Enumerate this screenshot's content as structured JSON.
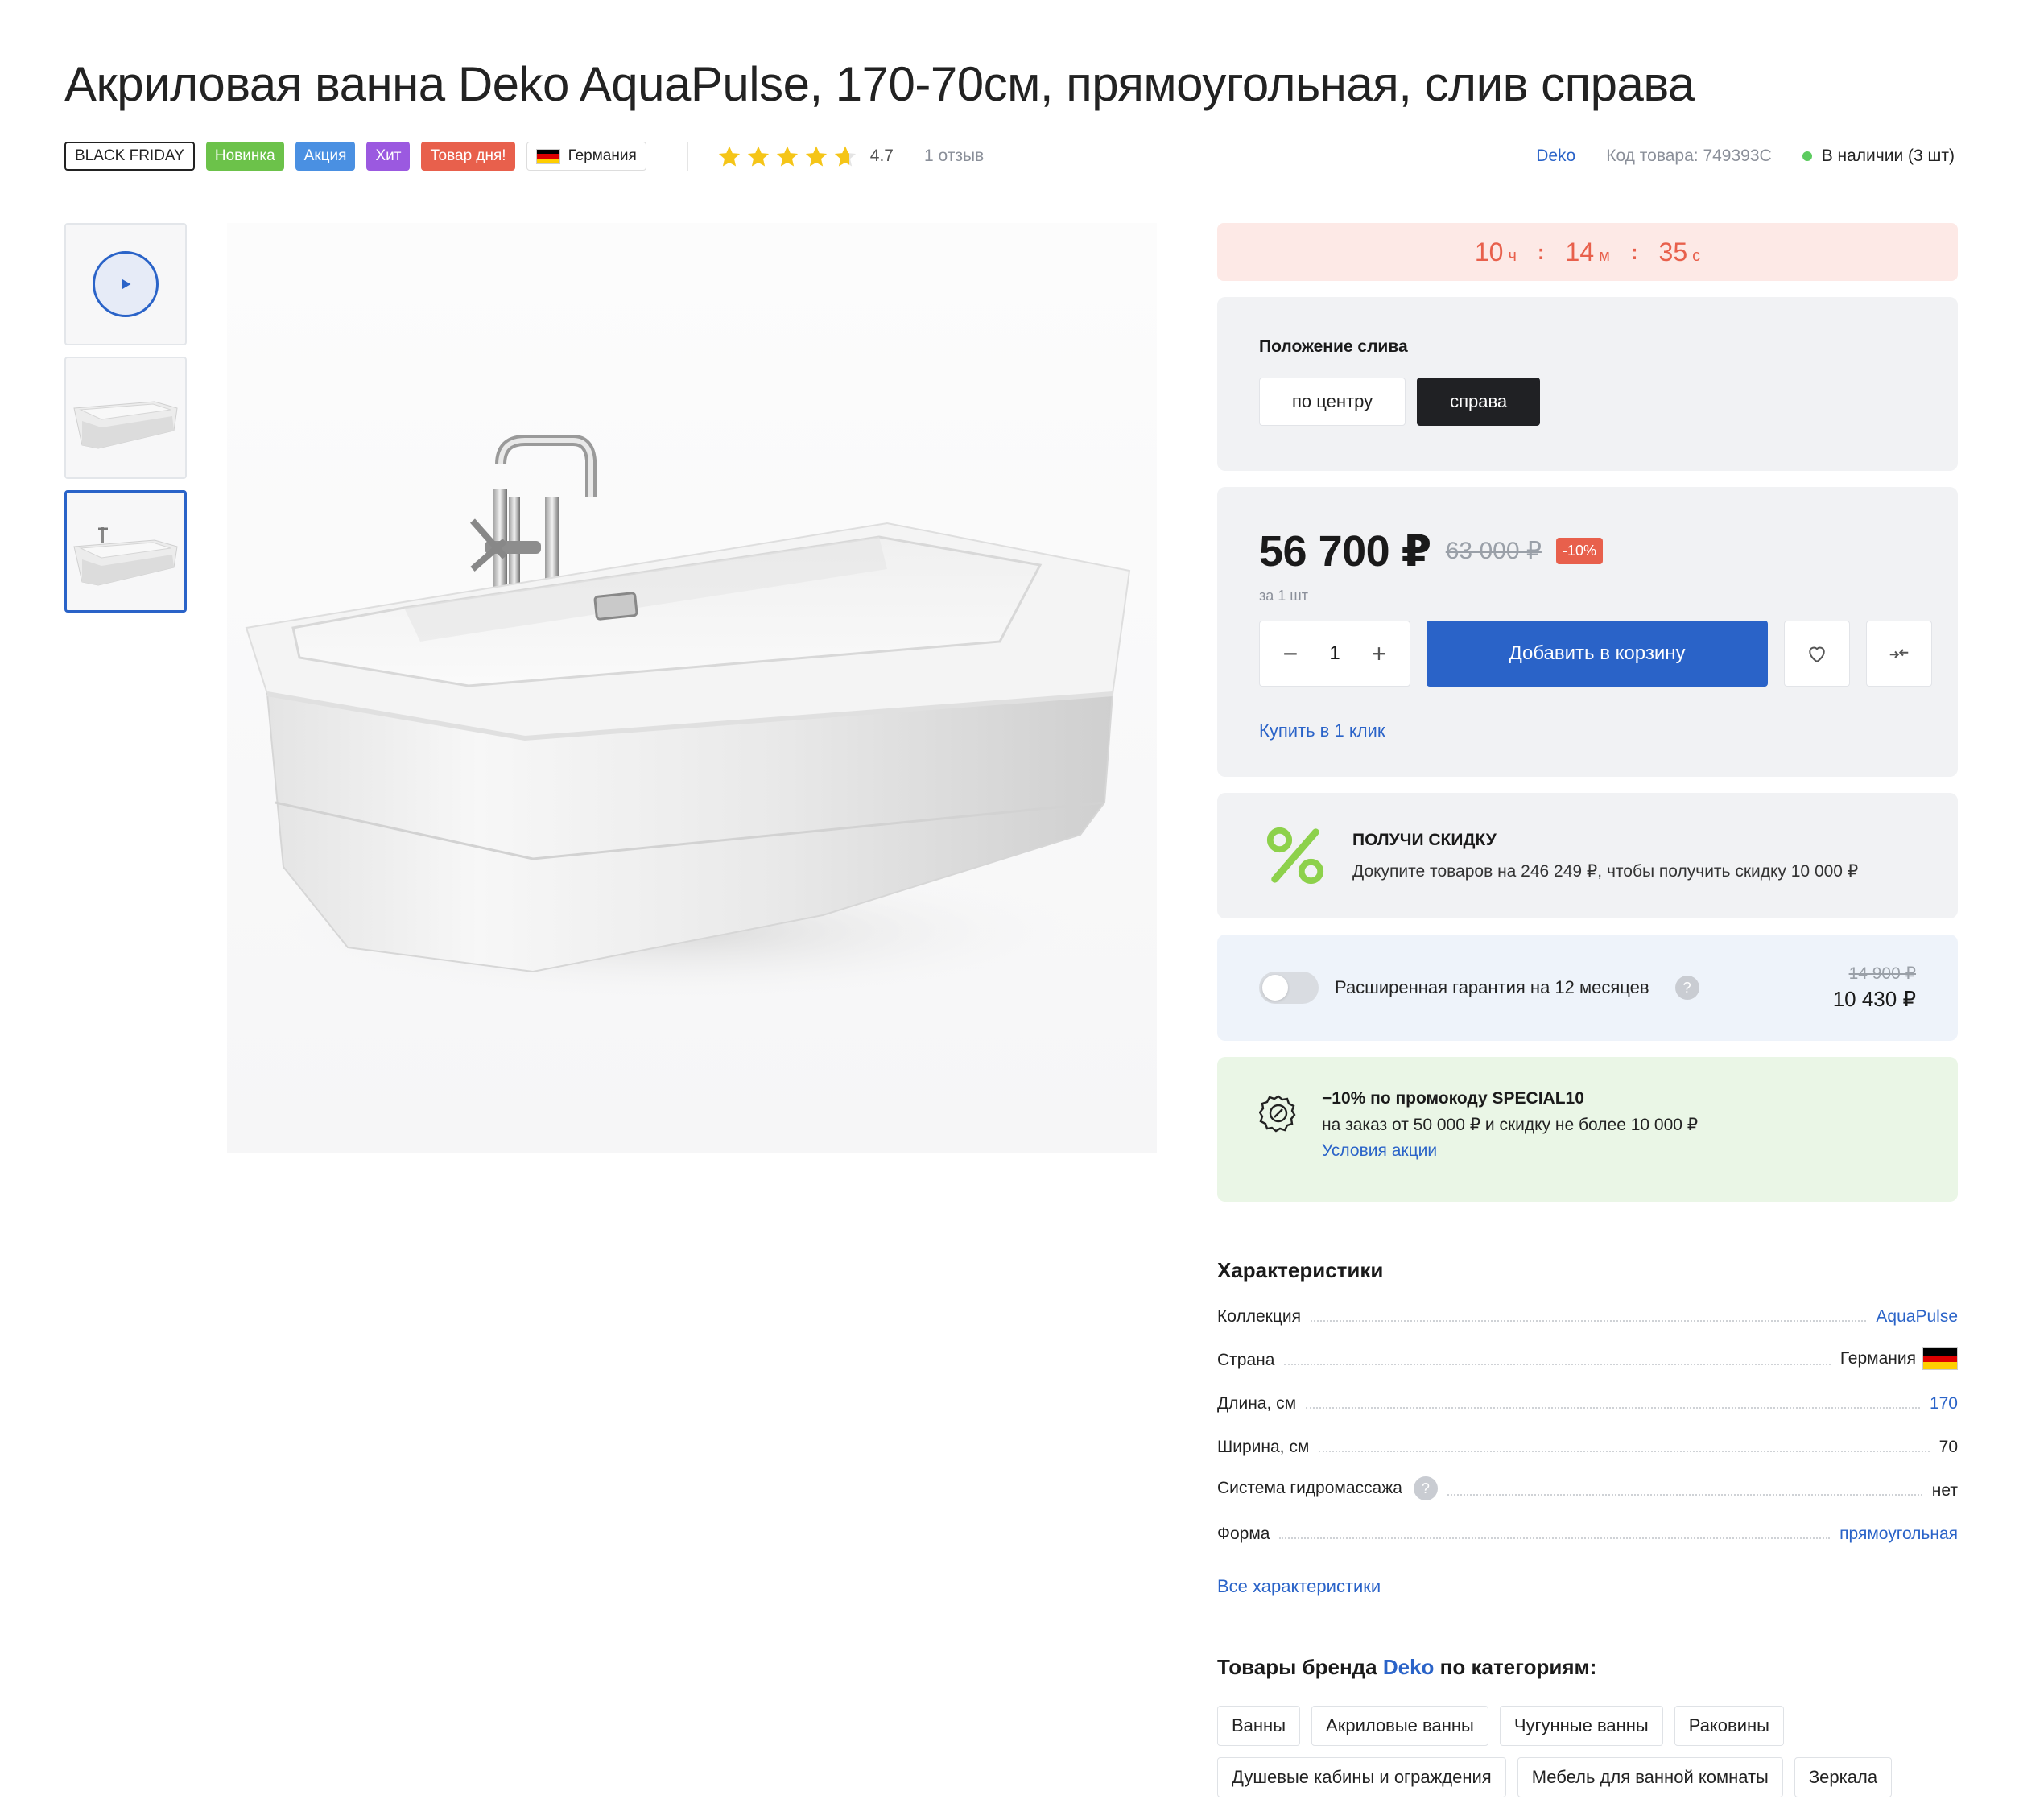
{
  "title": "Акриловая ванна Deko AquaPulse, 170-70см, прямоугольная, слив справа",
  "badges": {
    "black_friday": "BLACK FRIDAY",
    "new": "Новинка",
    "promo": "Акция",
    "hit": "Хит",
    "day": "Товар дня!",
    "country": "Германия"
  },
  "rating": {
    "stars": 4.7,
    "value": "4.7",
    "reviews": "1 отзыв"
  },
  "meta": {
    "brand": "Deko",
    "sku": "Код товара: 749393С",
    "stock": "В наличии (3 шт)",
    "stock_color": "#5ccb5f"
  },
  "gallery": {
    "thumbs": [
      "video",
      "image",
      "image"
    ],
    "active_index": 2,
    "icons": {
      "play": "play-icon"
    }
  },
  "timer": {
    "hours": "10",
    "hours_unit": "ч",
    "minutes": "14",
    "minutes_unit": "м",
    "seconds": "35",
    "seconds_unit": "с",
    "color": "#e8604c"
  },
  "drain": {
    "title": "Положение слива",
    "options": [
      "по центру",
      "справа"
    ],
    "selected": "справа"
  },
  "price": {
    "current": "56 700 ₽",
    "old": "63 000 ₽",
    "discount": "-10%",
    "per_unit": "за 1 шт",
    "quantity": "1",
    "minus": "−",
    "plus": "+",
    "add_to_cart": "Добавить в корзину",
    "one_click": "Купить в 1 клик",
    "icons": {
      "wishlist": "heart-icon",
      "compare": "compare-icon"
    }
  },
  "discount_offer": {
    "title": "ПОЛУЧИ СКИДКУ",
    "text": "Докупите товаров на 246 249 ₽, чтобы получить скидку 10 000 ₽",
    "icon": "percent-icon"
  },
  "warranty": {
    "label": "Расширенная гарантия на 12 месяцев",
    "help": "?",
    "old_price": "14 900 ₽",
    "price": "10 430 ₽",
    "enabled": false
  },
  "promo_code": {
    "title": "−10% по промокоду SPECIAL10",
    "text": "на заказ от 50 000 ₽ и скидку не более 10 000 ₽",
    "link": "Условия акции",
    "icon": "discount-badge-icon"
  },
  "specs": {
    "title": "Характеристики",
    "rows": [
      {
        "label": "Коллекция",
        "value": "AquaPulse",
        "link": true
      },
      {
        "label": "Страна",
        "value": "Германия",
        "link": false
      },
      {
        "label": "Длина, см",
        "value": "170",
        "link": true
      },
      {
        "label": "Ширина, см",
        "value": "70",
        "link": false
      },
      {
        "label": "Система гидромассажа",
        "value": "нет",
        "link": false
      },
      {
        "label": "Форма",
        "value": "прямоугольная",
        "link": true
      }
    ],
    "help": "?",
    "all_link": "Все характеристики"
  },
  "brand_categories": {
    "title_before": "Товары бренда",
    "brand": "Deko",
    "title_after": "по категориям:",
    "tags": [
      "Ванны",
      "Акриловые ванны",
      "Чугунные ванны",
      "Раковины",
      "Душевые кабины и ограждения",
      "Мебель для ванной комнаты",
      "Зеркала"
    ]
  },
  "colors": {
    "accent": "#2a63c8",
    "badge_new": "#6cc24a",
    "badge_promo": "#4a90e2",
    "badge_hit": "#9b59e0",
    "badge_day": "#e8604c",
    "star": "#f5c518",
    "promo_bg": "#eaf6e6",
    "warranty_bg": "#eef3fa"
  }
}
